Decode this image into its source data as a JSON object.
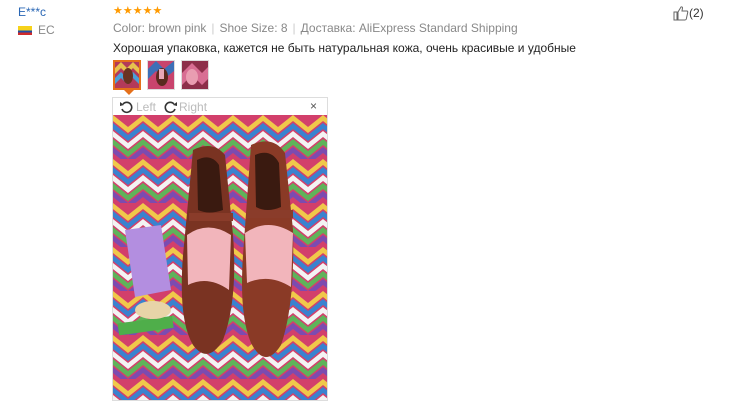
{
  "review": {
    "username": "E***c",
    "country": "EC",
    "stars": "★★★★★",
    "color_label": "Color: brown pink",
    "shoe_size": "Shoe Size: 8",
    "shipping": "Доставка: AliExpress Standard Shipping",
    "text": "Хорошая упаковка, кажется не быть натуральная кожа, очень красивые и удобные",
    "likes": "(2)"
  },
  "viewer": {
    "rotate_left": "Left",
    "rotate_right": "Right",
    "close": "×"
  },
  "colors": {
    "accent": "#e5701a",
    "link": "#2a67b5",
    "star": "#ff9a00"
  }
}
